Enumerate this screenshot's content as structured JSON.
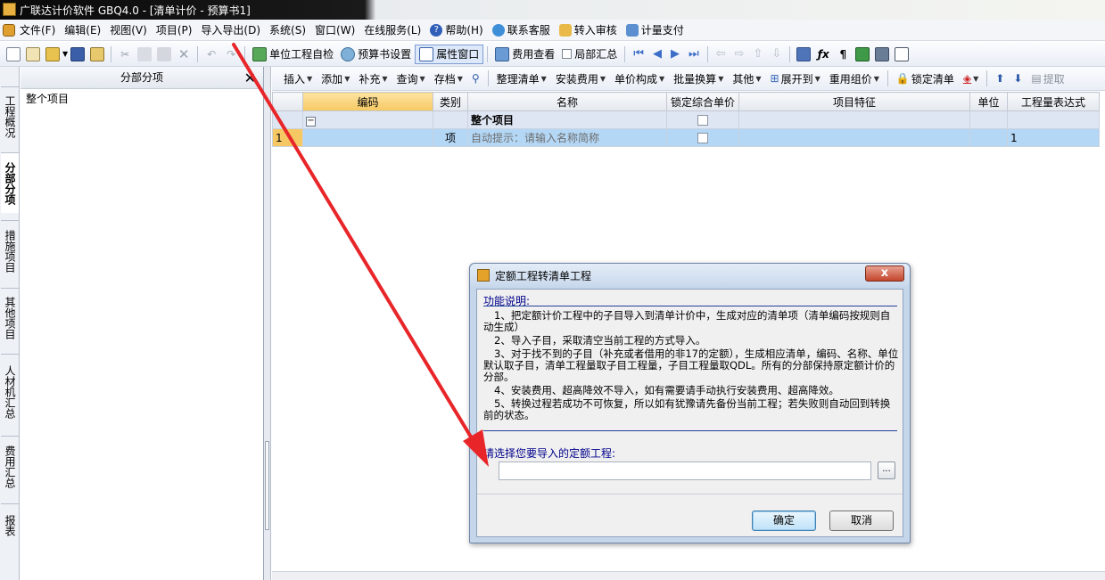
{
  "window": {
    "title": "广联达计价软件 GBQ4.0 - [清单计价 - 预算书1]"
  },
  "menubar": {
    "items": [
      "文件(F)",
      "编辑(E)",
      "视图(V)",
      "项目(P)",
      "导入导出(D)",
      "系统(S)",
      "窗口(W)",
      "在线服务(L)",
      "帮助(H)",
      "联系客服",
      "转入审核",
      "计量支付"
    ]
  },
  "toolbar1": {
    "self_check": "单位工程自检",
    "budget_settings": "预算书设置",
    "property_window": "属性窗口",
    "fee_view": "费用查看",
    "local_summary": "局部汇总"
  },
  "left_tabs": [
    "工程概况",
    "分部分项",
    "措施项目",
    "其他项目",
    "人材机汇总",
    "费用汇总",
    "报表"
  ],
  "tree_panel": {
    "title": "分部分项",
    "close": "✕",
    "root": "整个项目"
  },
  "toolbar2": {
    "items": [
      "插入",
      "添加",
      "补充",
      "查询",
      "存档",
      "整理清单",
      "安装费用",
      "单价构成",
      "批量换算",
      "其他",
      "展开到",
      "重用组价",
      "锁定清单",
      "提取"
    ]
  },
  "grid": {
    "columns": [
      "",
      "编码",
      "类别",
      "名称",
      "锁定综合单价",
      "项目特征",
      "单位",
      "工程量表达式"
    ],
    "root_row": {
      "expander": "−",
      "name": "整个项目"
    },
    "row1": {
      "num": "1",
      "type": "项",
      "name_hint": "自动提示：请输入名称简称",
      "qty_expr": "1"
    }
  },
  "dialog": {
    "title": "定额工程转清单工程",
    "close": "x",
    "heading": "功能说明:",
    "lines": [
      "1、把定额计价工程中的子目导入到清单计价中，生成对应的清单项（清单编码按规则自动生成）",
      "2、导入子目，采取清空当前工程的方式导入。",
      "3、对于找不到的子目（补充或者借用的非17的定额），生成相应清单，编码、名称、单位默认取子目，清单工程量取子目工程量，子目工程量取QDL。所有的分部保持原定额计价的分部。",
      "4、安装费用、超高降效不导入，如有需要请手动执行安装费用、超高降效。",
      "5、转换过程若成功不可恢复，所以如有犹豫请先备份当前工程；若失败则自动回到转换前的状态。"
    ],
    "choose_label": "请选择您要导入的定额工程:",
    "path_value": "",
    "browse": "...",
    "ok": "确定",
    "cancel": "取消"
  },
  "colors": {
    "annotation_arrow": "#e8262a",
    "selection_row": "#b4d7f5",
    "header_highlight": "#f6c863"
  }
}
